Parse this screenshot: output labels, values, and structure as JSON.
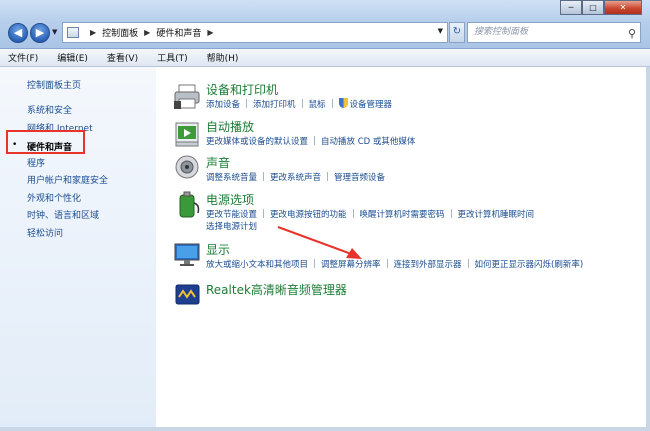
{
  "window": {
    "controls": {
      "minimize": "─",
      "maximize": "□",
      "close": "✕"
    }
  },
  "address": {
    "crumbs": [
      "控制面板",
      "硬件和声音"
    ],
    "search_placeholder": "搜索控制面板"
  },
  "menu": [
    "文件(F)",
    "编辑(E)",
    "查看(V)",
    "工具(T)",
    "帮助(H)"
  ],
  "sidebar": {
    "items": [
      {
        "label": "控制面板主页"
      },
      {
        "label": "系统和安全"
      },
      {
        "label": "网络和 Internet"
      },
      {
        "label": "硬件和声音",
        "current": true
      },
      {
        "label": "程序"
      },
      {
        "label": "用户帐户和家庭安全"
      },
      {
        "label": "外观和个性化"
      },
      {
        "label": "时钟、语言和区域"
      },
      {
        "label": "轻松访问"
      }
    ]
  },
  "categories": [
    {
      "title": "设备和打印机",
      "icon": "printer-icon",
      "links": [
        "添加设备",
        "添加打印机",
        "鼠标",
        "设备管理器"
      ]
    },
    {
      "title": "自动播放",
      "icon": "autoplay-icon",
      "links": [
        "更改媒体或设备的默认设置",
        "自动播放 CD 或其他媒体"
      ]
    },
    {
      "title": "声音",
      "icon": "speaker-icon",
      "links": [
        "调整系统音量",
        "更改系统声音",
        "管理音频设备"
      ]
    },
    {
      "title": "电源选项",
      "icon": "battery-icon",
      "links": [
        "更改节能设置",
        "更改电源按钮的功能",
        "唤醒计算机时需要密码",
        "更改计算机睡眠时间"
      ],
      "links2": [
        "选择电源计划"
      ]
    },
    {
      "title": "显示",
      "icon": "monitor-icon",
      "links": [
        "放大或缩小文本和其他项目",
        "调整屏幕分辨率",
        "连接到外部显示器",
        "如何更正显示器闪烁(刷新率)"
      ]
    },
    {
      "title": "Realtek高清晰音频管理器",
      "icon": "realtek-icon",
      "links": []
    }
  ],
  "colors": {
    "link": "#1a4d91",
    "category_title": "#1b7d35",
    "highlight_box": "#e8332b",
    "annotation_arrow": "#e8332b"
  }
}
